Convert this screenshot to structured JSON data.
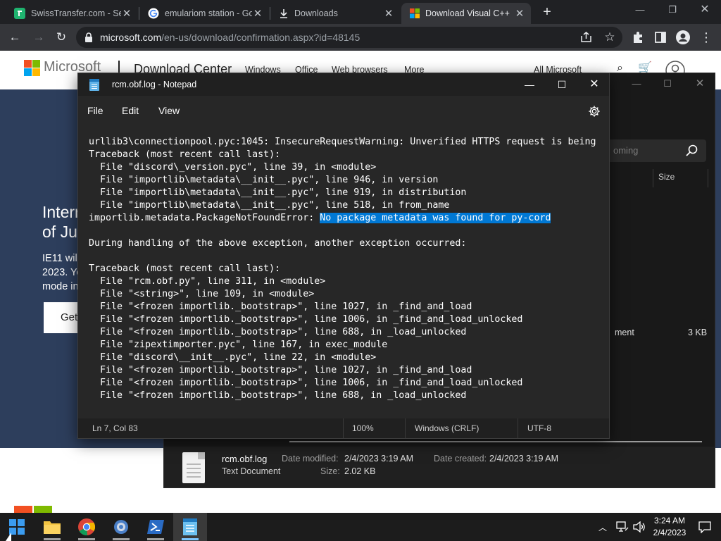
{
  "browser": {
    "tabs": [
      {
        "label": "SwissTransfer.com - Se",
        "icon": "swisstransfer-favicon"
      },
      {
        "label": "emulariom station - Go",
        "icon": "google-favicon"
      },
      {
        "label": "Downloads",
        "icon": "download-arrow-icon"
      },
      {
        "label": "Download Visual C++ ",
        "icon": "microsoft-favicon"
      }
    ],
    "active_tab_index": 3,
    "address_bar": {
      "host": "microsoft.com",
      "path": "/en-us/download/confirmation.aspx?id=48145"
    }
  },
  "webpage": {
    "brand": "Microsoft",
    "section": "Download Center",
    "nav": [
      "Windows",
      "Office",
      "Web browsers",
      "More",
      "All Microsoft"
    ],
    "hero_title_lines": [
      "Interr",
      "of Jun"
    ],
    "hero_text_lines": [
      "IE11 wil",
      "2023. Yo",
      "mode in"
    ],
    "hero_button": "Get"
  },
  "explorer": {
    "search_placeholder": "oming",
    "columns": [
      "Size"
    ],
    "row": {
      "type": "ment",
      "size": "3 KB"
    },
    "details": {
      "file_name": "rcm.obf.log",
      "file_type": "Text Document",
      "date_modified_label": "Date modified:",
      "date_modified": "2/4/2023 3:19 AM",
      "date_created_label": "Date created:",
      "date_created": "2/4/2023 3:19 AM",
      "size_label": "Size:",
      "size": "2.02 KB"
    }
  },
  "notepad": {
    "title": "rcm.obf.log - Notepad",
    "menu": [
      "File",
      "Edit",
      "View"
    ],
    "lines": [
      "urllib3\\connectionpool.pyc:1045: InsecureRequestWarning: Unverified HTTPS request is being",
      "Traceback (most recent call last):",
      "  File \"discord\\_version.pyc\", line 39, in <module>",
      "  File \"importlib\\metadata\\__init__.pyc\", line 946, in version",
      "  File \"importlib\\metadata\\__init__.pyc\", line 919, in distribution",
      "  File \"importlib\\metadata\\__init__.pyc\", line 518, in from_name",
      "importlib.metadata.PackageNotFoundError: ",
      "",
      "During handling of the above exception, another exception occurred:",
      "",
      "Traceback (most recent call last):",
      "  File \"rcm.obf.py\", line 311, in <module>",
      "  File \"<string>\", line 109, in <module>",
      "  File \"<frozen importlib._bootstrap>\", line 1027, in _find_and_load",
      "  File \"<frozen importlib._bootstrap>\", line 1006, in _find_and_load_unlocked",
      "  File \"<frozen importlib._bootstrap>\", line 688, in _load_unlocked",
      "  File \"zipextimporter.pyc\", line 167, in exec_module",
      "  File \"discord\\__init__.pyc\", line 22, in <module>",
      "  File \"<frozen importlib._bootstrap>\", line 1027, in _find_and_load",
      "  File \"<frozen importlib._bootstrap>\", line 1006, in _find_and_load_unlocked",
      "  File \"<frozen importlib._bootstrap>\", line 688, in _load_unlocked"
    ],
    "selected_text": "No package metadata was found for py-cord",
    "selected_line_index": 6,
    "status": {
      "cursor": "Ln 7, Col 83",
      "zoom": "100%",
      "line_endings": "Windows (CRLF)",
      "encoding": "UTF-8"
    }
  },
  "taskbar": {
    "apps": [
      "windows-start",
      "file-explorer",
      "google-chrome",
      "control-panel",
      "powershell",
      "notepad"
    ],
    "active_app": "notepad",
    "clock": {
      "time": "3:24 AM",
      "date": "2/4/2023"
    }
  },
  "colors": {
    "selection": "#0078d4",
    "notepad_bg": "#272727",
    "hero_bg": "#2d3e5c",
    "chrome_frame": "#202124"
  }
}
